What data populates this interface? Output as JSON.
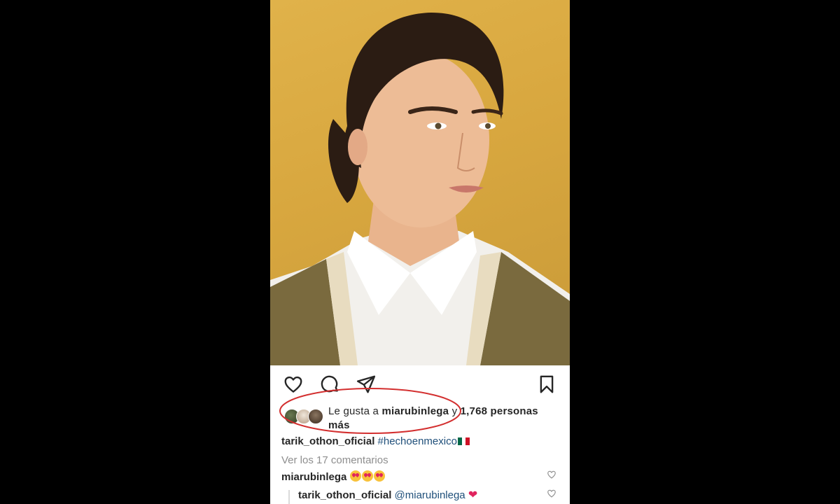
{
  "post": {
    "photo_alt": "",
    "likes": {
      "prefix": "Le gusta a ",
      "liker": "miarubinlega",
      "middle": " y ",
      "count": "1,768 personas",
      "suffix": "más"
    },
    "caption": {
      "username": "tarik_othon_oficial",
      "hashtag": "#hechoenmexico"
    },
    "view_comments": "Ver los 17 comentarios",
    "comments": [
      {
        "username": "miarubinlega",
        "text": ""
      },
      {
        "username": "tarik_othon_oficial",
        "mention": "@miarubinlega"
      }
    ]
  },
  "icons": [
    "heart-icon",
    "comment-icon",
    "share-icon",
    "bookmark-icon",
    "flag-mexico-icon",
    "heart-eyes-emoji",
    "red-heart-emoji"
  ],
  "colors": {
    "accent_oval": "#d32f2f",
    "link": "#1f4f7a",
    "muted": "#8e8e8e",
    "text": "#262626",
    "heart": "#e0245e"
  }
}
